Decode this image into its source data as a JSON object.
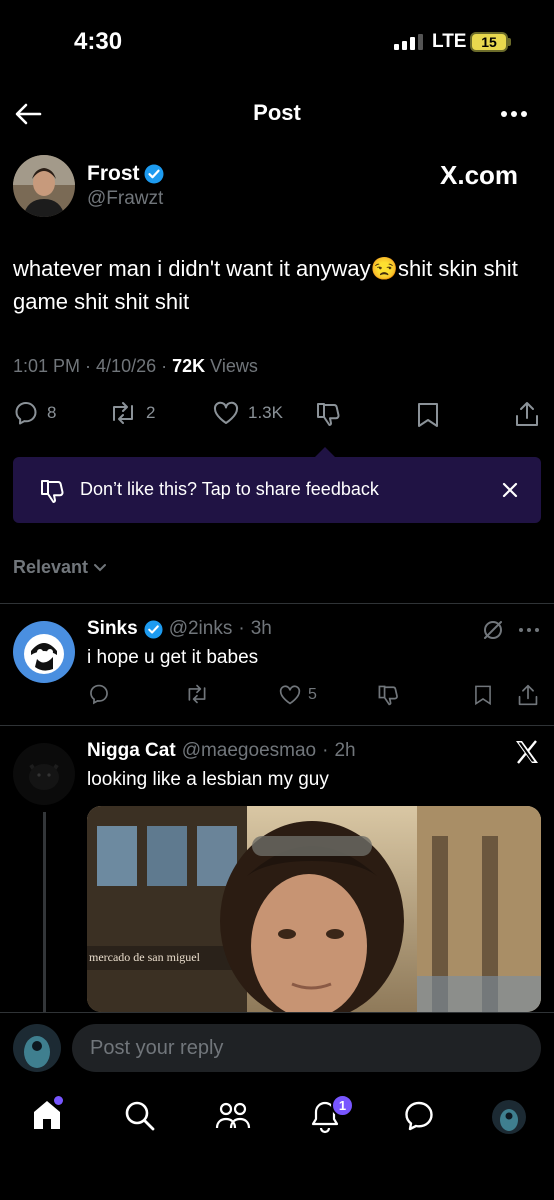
{
  "status_bar": {
    "time": "4:30",
    "network": "LTE",
    "battery": "15"
  },
  "header": {
    "title": "Post"
  },
  "post": {
    "author_name": "Frost",
    "author_handle": "@Frawzt",
    "source_badge": "X.com",
    "text": "whatever man i didn't want it anyway😒shit skin shit game shit shit shit",
    "time": "1:01 PM",
    "date": "4/10/26",
    "views_count": "72K",
    "views_label": "Views",
    "replies": "8",
    "reposts": "2",
    "likes": "1.3K"
  },
  "feedback_banner": {
    "text": "Don’t like this? Tap to share feedback"
  },
  "sort": {
    "label": "Relevant"
  },
  "replies": [
    {
      "name": "Sinks",
      "handle": "@2inks",
      "age": "3h",
      "text": "i hope u get it babes",
      "likes": "5"
    },
    {
      "name": "Nigga Cat",
      "handle": "@maegoesmao",
      "age": "2h",
      "text": "looking like a lesbian my guy",
      "photo_sign_text": "mercado de san miguel"
    }
  ],
  "composer": {
    "placeholder": "Post your reply"
  },
  "tabbar": {
    "notifications_badge": "1"
  },
  "colors": {
    "background": "#000000",
    "verified": "#1d9bf0",
    "banner": "#201344",
    "accent_dot": "#7856ff"
  }
}
